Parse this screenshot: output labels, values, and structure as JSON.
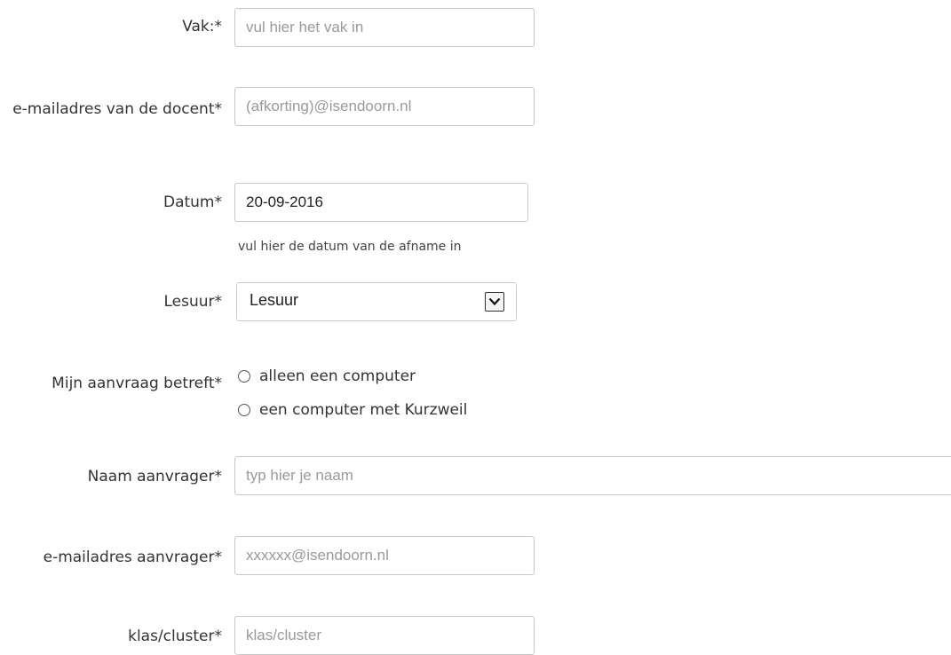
{
  "form": {
    "vak": {
      "label": "Vak:*",
      "placeholder": "vul hier het vak in",
      "value": ""
    },
    "email_docent": {
      "label": "e-mailadres van de docent*",
      "placeholder": "(afkorting)@isendoorn.nl",
      "value": ""
    },
    "datum": {
      "label": "Datum*",
      "value": "20-09-2016",
      "hint": "vul hier de datum van de afname in"
    },
    "lesuur": {
      "label": "Lesuur*",
      "selected": "Lesuur",
      "icon": "chevron-down-icon"
    },
    "aanvraag": {
      "label": "Mijn aanvraag betreft*",
      "options": [
        {
          "label": "alleen een computer",
          "checked": false
        },
        {
          "label": "een computer met Kurzweil",
          "checked": false
        }
      ]
    },
    "naam_aanvrager": {
      "label": "Naam aanvrager*",
      "placeholder": "typ hier je naam",
      "value": ""
    },
    "email_aanvrager": {
      "label": "e-mailadres aanvrager*",
      "placeholder": "xxxxxx@isendoorn.nl",
      "value": ""
    },
    "klas": {
      "label": "klas/cluster*",
      "placeholder": "klas/cluster",
      "value": ""
    }
  },
  "colors": {
    "border": "#c8c8c8",
    "text": "#333333",
    "placeholder": "#9a9a9a"
  }
}
